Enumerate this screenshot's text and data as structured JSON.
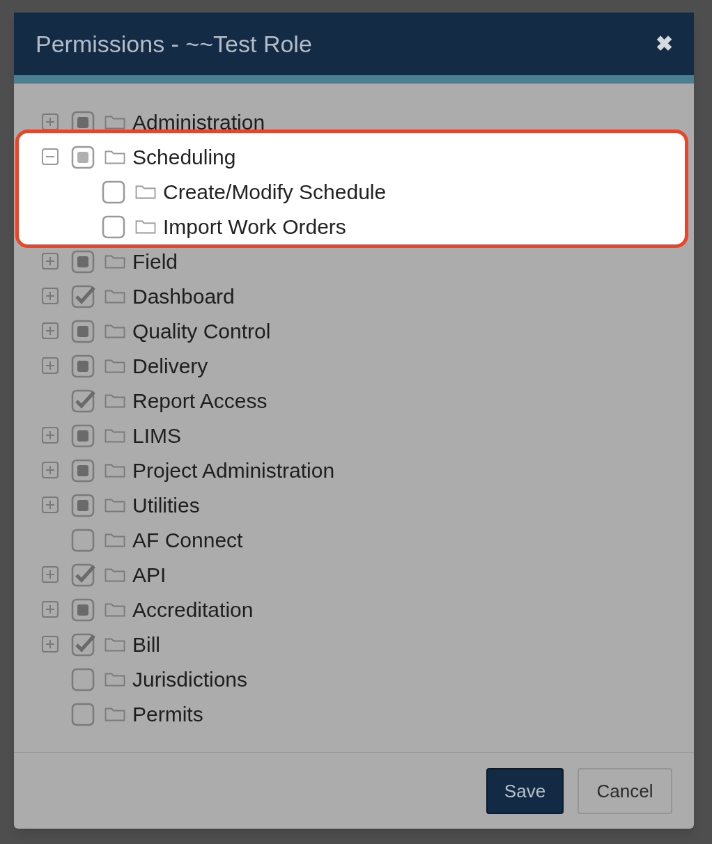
{
  "dialog": {
    "title": "Permissions - ~~Test Role",
    "close": "✖"
  },
  "items": [
    {
      "label": "Administration",
      "expandable": true,
      "expanded": false,
      "checked": false,
      "partial": true,
      "highlighted": false
    },
    {
      "label": "Scheduling",
      "expandable": true,
      "expanded": true,
      "checked": false,
      "partial": true,
      "highlighted": true,
      "children": [
        {
          "label": "Create/Modify Schedule",
          "expandable": false,
          "expanded": false,
          "checked": false,
          "partial": false
        },
        {
          "label": "Import Work Orders",
          "expandable": false,
          "expanded": false,
          "checked": false,
          "partial": false
        }
      ]
    },
    {
      "label": "Field",
      "expandable": true,
      "expanded": false,
      "checked": false,
      "partial": true,
      "highlighted": false
    },
    {
      "label": "Dashboard",
      "expandable": true,
      "expanded": false,
      "checked": true,
      "partial": false,
      "highlighted": false
    },
    {
      "label": "Quality Control",
      "expandable": true,
      "expanded": false,
      "checked": false,
      "partial": true,
      "highlighted": false
    },
    {
      "label": "Delivery",
      "expandable": true,
      "expanded": false,
      "checked": false,
      "partial": true,
      "highlighted": false
    },
    {
      "label": "Report Access",
      "expandable": false,
      "expanded": false,
      "checked": true,
      "partial": false,
      "highlighted": false
    },
    {
      "label": "LIMS",
      "expandable": true,
      "expanded": false,
      "checked": false,
      "partial": true,
      "highlighted": false
    },
    {
      "label": "Project Administration",
      "expandable": true,
      "expanded": false,
      "checked": false,
      "partial": true,
      "highlighted": false
    },
    {
      "label": "Utilities",
      "expandable": true,
      "expanded": false,
      "checked": false,
      "partial": true,
      "highlighted": false
    },
    {
      "label": "AF Connect",
      "expandable": false,
      "expanded": false,
      "checked": false,
      "partial": false,
      "highlighted": false
    },
    {
      "label": "API",
      "expandable": true,
      "expanded": false,
      "checked": true,
      "partial": false,
      "highlighted": false
    },
    {
      "label": "Accreditation",
      "expandable": true,
      "expanded": false,
      "checked": false,
      "partial": true,
      "highlighted": false
    },
    {
      "label": "Bill",
      "expandable": true,
      "expanded": false,
      "checked": true,
      "partial": false,
      "highlighted": false
    },
    {
      "label": "Jurisdictions",
      "expandable": false,
      "expanded": false,
      "checked": false,
      "partial": false,
      "highlighted": false
    },
    {
      "label": "Permits",
      "expandable": false,
      "expanded": false,
      "checked": false,
      "partial": false,
      "highlighted": false
    }
  ],
  "buttons": [
    {
      "label": "Save",
      "kind": "primary"
    },
    {
      "label": "Cancel",
      "kind": "secondary"
    }
  ]
}
